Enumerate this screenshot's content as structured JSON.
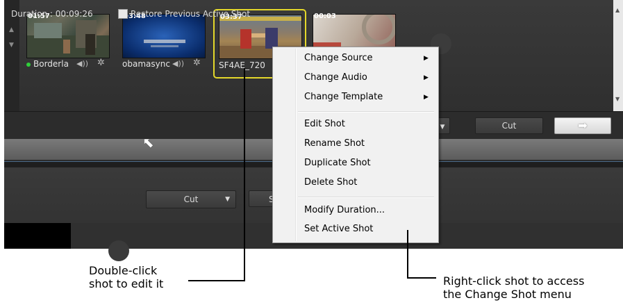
{
  "shots": [
    {
      "time": "01:57",
      "name": "Borderla",
      "live": true
    },
    {
      "time": "03:48",
      "name": "obamasync",
      "live": false
    },
    {
      "time": "03:37",
      "name": "SF4AE_720",
      "live": false
    },
    {
      "time": "00:03",
      "name": "",
      "live": false
    }
  ],
  "duration_bar": {
    "duration_label": "Duration : 00:09:26",
    "restore_label": "Restore Previous Active Shot",
    "cut_label": "Cut"
  },
  "lower_panel": {
    "cut_label": "Cut",
    "partial_label": "S"
  },
  "context_menu": {
    "items": [
      {
        "label": "Change Source",
        "submenu": true
      },
      {
        "label": "Change Audio",
        "submenu": true
      },
      {
        "label": "Change Template",
        "submenu": true
      },
      {
        "label": "Edit Shot"
      },
      {
        "label": "Rename Shot"
      },
      {
        "label": "Duplicate Shot"
      },
      {
        "label": "Delete Shot"
      },
      {
        "label": "Modify Duration..."
      },
      {
        "label": "Set Active Shot"
      }
    ]
  },
  "callouts": {
    "left_line1": "Double-click",
    "left_line2": "shot to edit it",
    "right_line1": "Right-click shot to access",
    "right_line2": "the Change Shot menu"
  },
  "colors": {
    "selected_border": "#e4d82a",
    "live_dot": "#2fcf3a"
  },
  "icons": [
    "volume-icon",
    "gear-icon",
    "submenu-arrow-icon",
    "scroll-up-icon",
    "scroll-down-icon",
    "mouse-cursor-icon",
    "take-arrow-icon"
  ]
}
